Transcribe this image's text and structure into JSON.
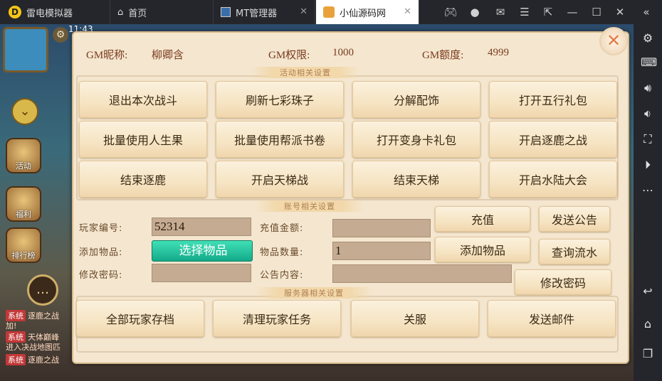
{
  "window": {
    "app_name": "雷电模拟器",
    "tabs": [
      {
        "label": "首页"
      },
      {
        "label": "MT管理器"
      },
      {
        "label": "小仙源码网"
      }
    ]
  },
  "game": {
    "time": "11:43",
    "side_buttons": [
      "活动",
      "福利",
      "排行榜"
    ],
    "chat": [
      {
        "tag": "系统",
        "text": "逐鹿之战"
      },
      {
        "tag": "",
        "text": "加!"
      },
      {
        "tag": "系统",
        "text": "天体巅峰"
      },
      {
        "tag": "",
        "text": "进入决战地图匹"
      },
      {
        "tag": "系统",
        "text": "逐鹿之战"
      }
    ]
  },
  "gm": {
    "nickname_label": "GM昵称:",
    "nickname": "柳卿含",
    "perm_label": "GM权限:",
    "perm": "1000",
    "quota_label": "GM额度:",
    "quota": "4999"
  },
  "sections": {
    "activity": "活动相关设置",
    "account": "账号相关设置",
    "server": "服务器相关设置"
  },
  "activity_buttons": [
    "退出本次战斗",
    "刷新七彩珠子",
    "分解配饰",
    "打开五行礼包",
    "批量使用人生果",
    "批量使用帮派书卷",
    "打开变身卡礼包",
    "开启逐鹿之战",
    "结束逐鹿",
    "开启天梯战",
    "结束天梯",
    "开启水陆大会"
  ],
  "account": {
    "player_id_label": "玩家编号:",
    "player_id_value": "52314",
    "recharge_label": "充值金额:",
    "recharge_value": "",
    "add_item_label": "添加物品:",
    "choose_item_button": "选择物品",
    "item_qty_label": "物品数量:",
    "item_qty_value": "1",
    "change_pwd_label": "修改密码:",
    "change_pwd_value": "",
    "notice_label": "公告内容:",
    "notice_value": "",
    "buttons": {
      "recharge": "充值",
      "send_notice": "发送公告",
      "add_item": "添加物品",
      "query_log": "查询流水",
      "change_pwd": "修改密码"
    }
  },
  "server_buttons": [
    "全部玩家存档",
    "清理玩家任务",
    "关服",
    "发送邮件"
  ],
  "colors": {
    "panel": "#f4e6cf",
    "label": "#7a3a1e",
    "choose_button": "#25c7a0",
    "input": "#c4ab92"
  }
}
